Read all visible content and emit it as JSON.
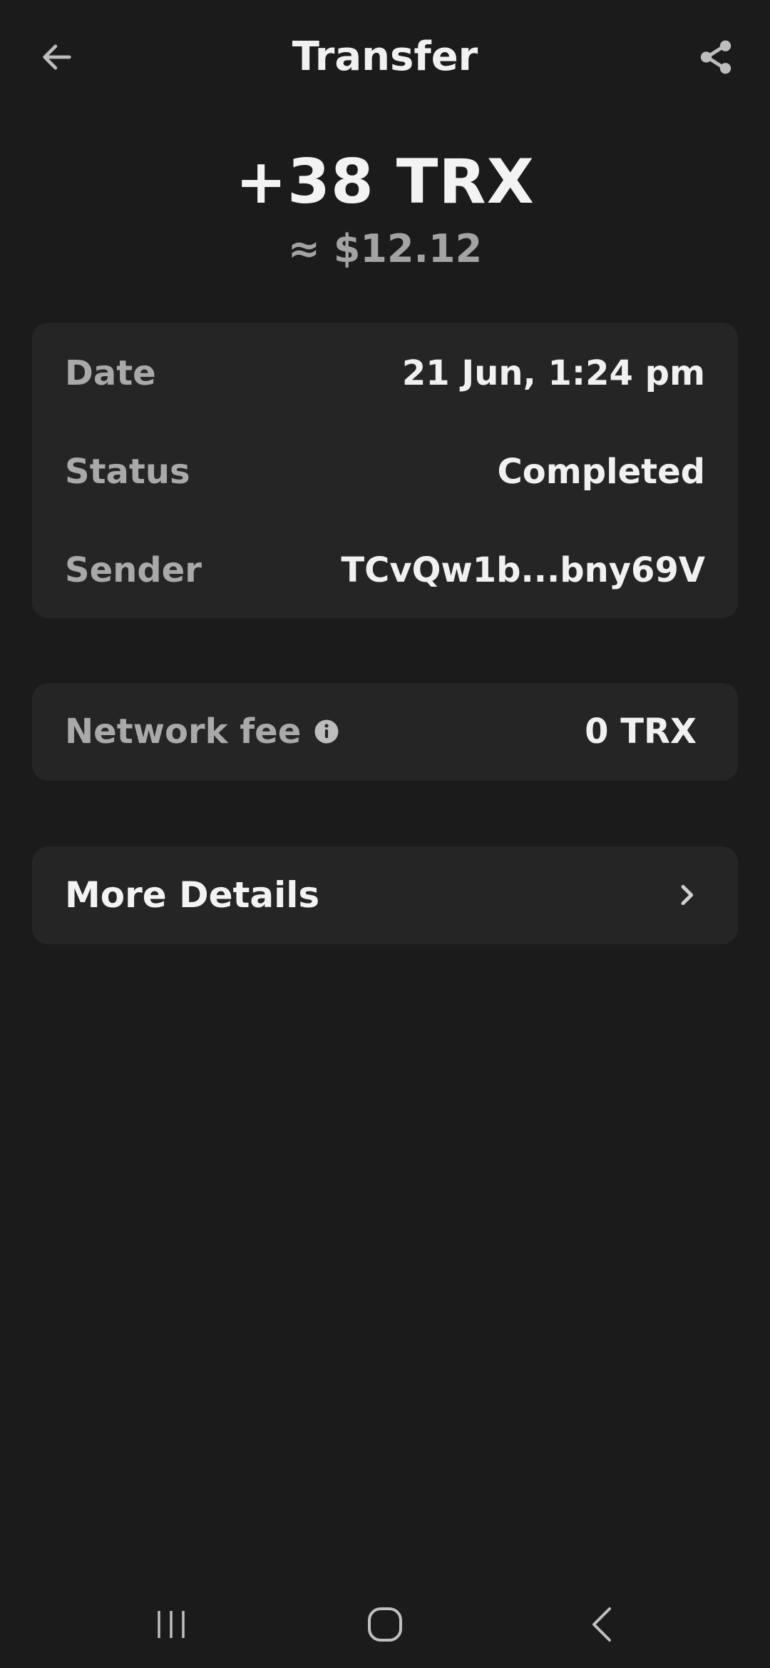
{
  "header": {
    "title": "Transfer",
    "back_icon": "arrow-left-icon",
    "share_icon": "share-icon"
  },
  "transaction": {
    "amount": "+38 TRX",
    "fiat_value": "≈ $12.12"
  },
  "details": {
    "rows": [
      {
        "label": "Date",
        "value": "21 Jun, 1:24 pm"
      },
      {
        "label": "Status",
        "value": "Completed"
      },
      {
        "label": "Sender",
        "value": "TCvQw1b...bny69V"
      }
    ]
  },
  "fee": {
    "label": "Network fee",
    "icon": "info-icon",
    "value": "0 TRX"
  },
  "more": {
    "label": "More Details",
    "icon": "chevron-right-icon"
  },
  "system_nav": {
    "recents_icon": "recents-icon",
    "home_icon": "home-icon",
    "back_icon": "nav-back-icon"
  },
  "colors": {
    "background": "#1b1b1b",
    "card": "#252525",
    "label": "#a9a9a9",
    "value": "#f1f1f1"
  }
}
